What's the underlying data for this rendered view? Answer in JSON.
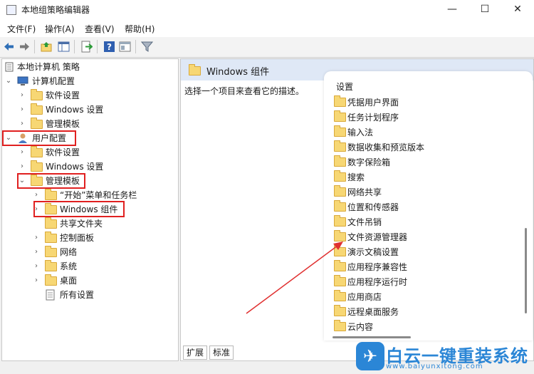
{
  "window": {
    "title": "本地组策略编辑器",
    "min": "—",
    "max": "☐",
    "close": "✕"
  },
  "menu": [
    "文件(F)",
    "操作(A)",
    "查看(V)",
    "帮助(H)"
  ],
  "tree": {
    "root": "本地计算机 策略",
    "computer": "计算机配置",
    "c_software": "软件设置",
    "c_windows": "Windows 设置",
    "c_admin": "管理模板",
    "user": "用户配置",
    "u_software": "软件设置",
    "u_windows": "Windows 设置",
    "u_admin": "管理模板",
    "start_menu": "“开始”菜单和任务栏",
    "win_components": "Windows 组件",
    "shared_folders": "共享文件夹",
    "control_panel": "控制面板",
    "network": "网络",
    "system": "系统",
    "desktop": "桌面",
    "all_settings": "所有设置"
  },
  "right": {
    "header": "Windows 组件",
    "description": "选择一个项目来查看它的描述。",
    "list_header": "设置",
    "items": [
      "凭据用户界面",
      "任务计划程序",
      "输入法",
      "数据收集和预览版本",
      "数字保险箱",
      "搜索",
      "网络共享",
      "位置和传感器",
      "文件吊销",
      "文件资源管理器",
      "演示文稿设置",
      "应用程序兼容性",
      "应用程序运行时",
      "应用商店",
      "远程桌面服务",
      "云内容"
    ]
  },
  "tabs": [
    "扩展",
    "标准"
  ],
  "logo": {
    "name": "白云一键重装系统",
    "url": "www.baiyunxitong.com"
  },
  "colors": {
    "highlight_box": "#e02020",
    "arrow": "#e03030",
    "logo": "#2b86d6",
    "folder": "#f7d774"
  }
}
